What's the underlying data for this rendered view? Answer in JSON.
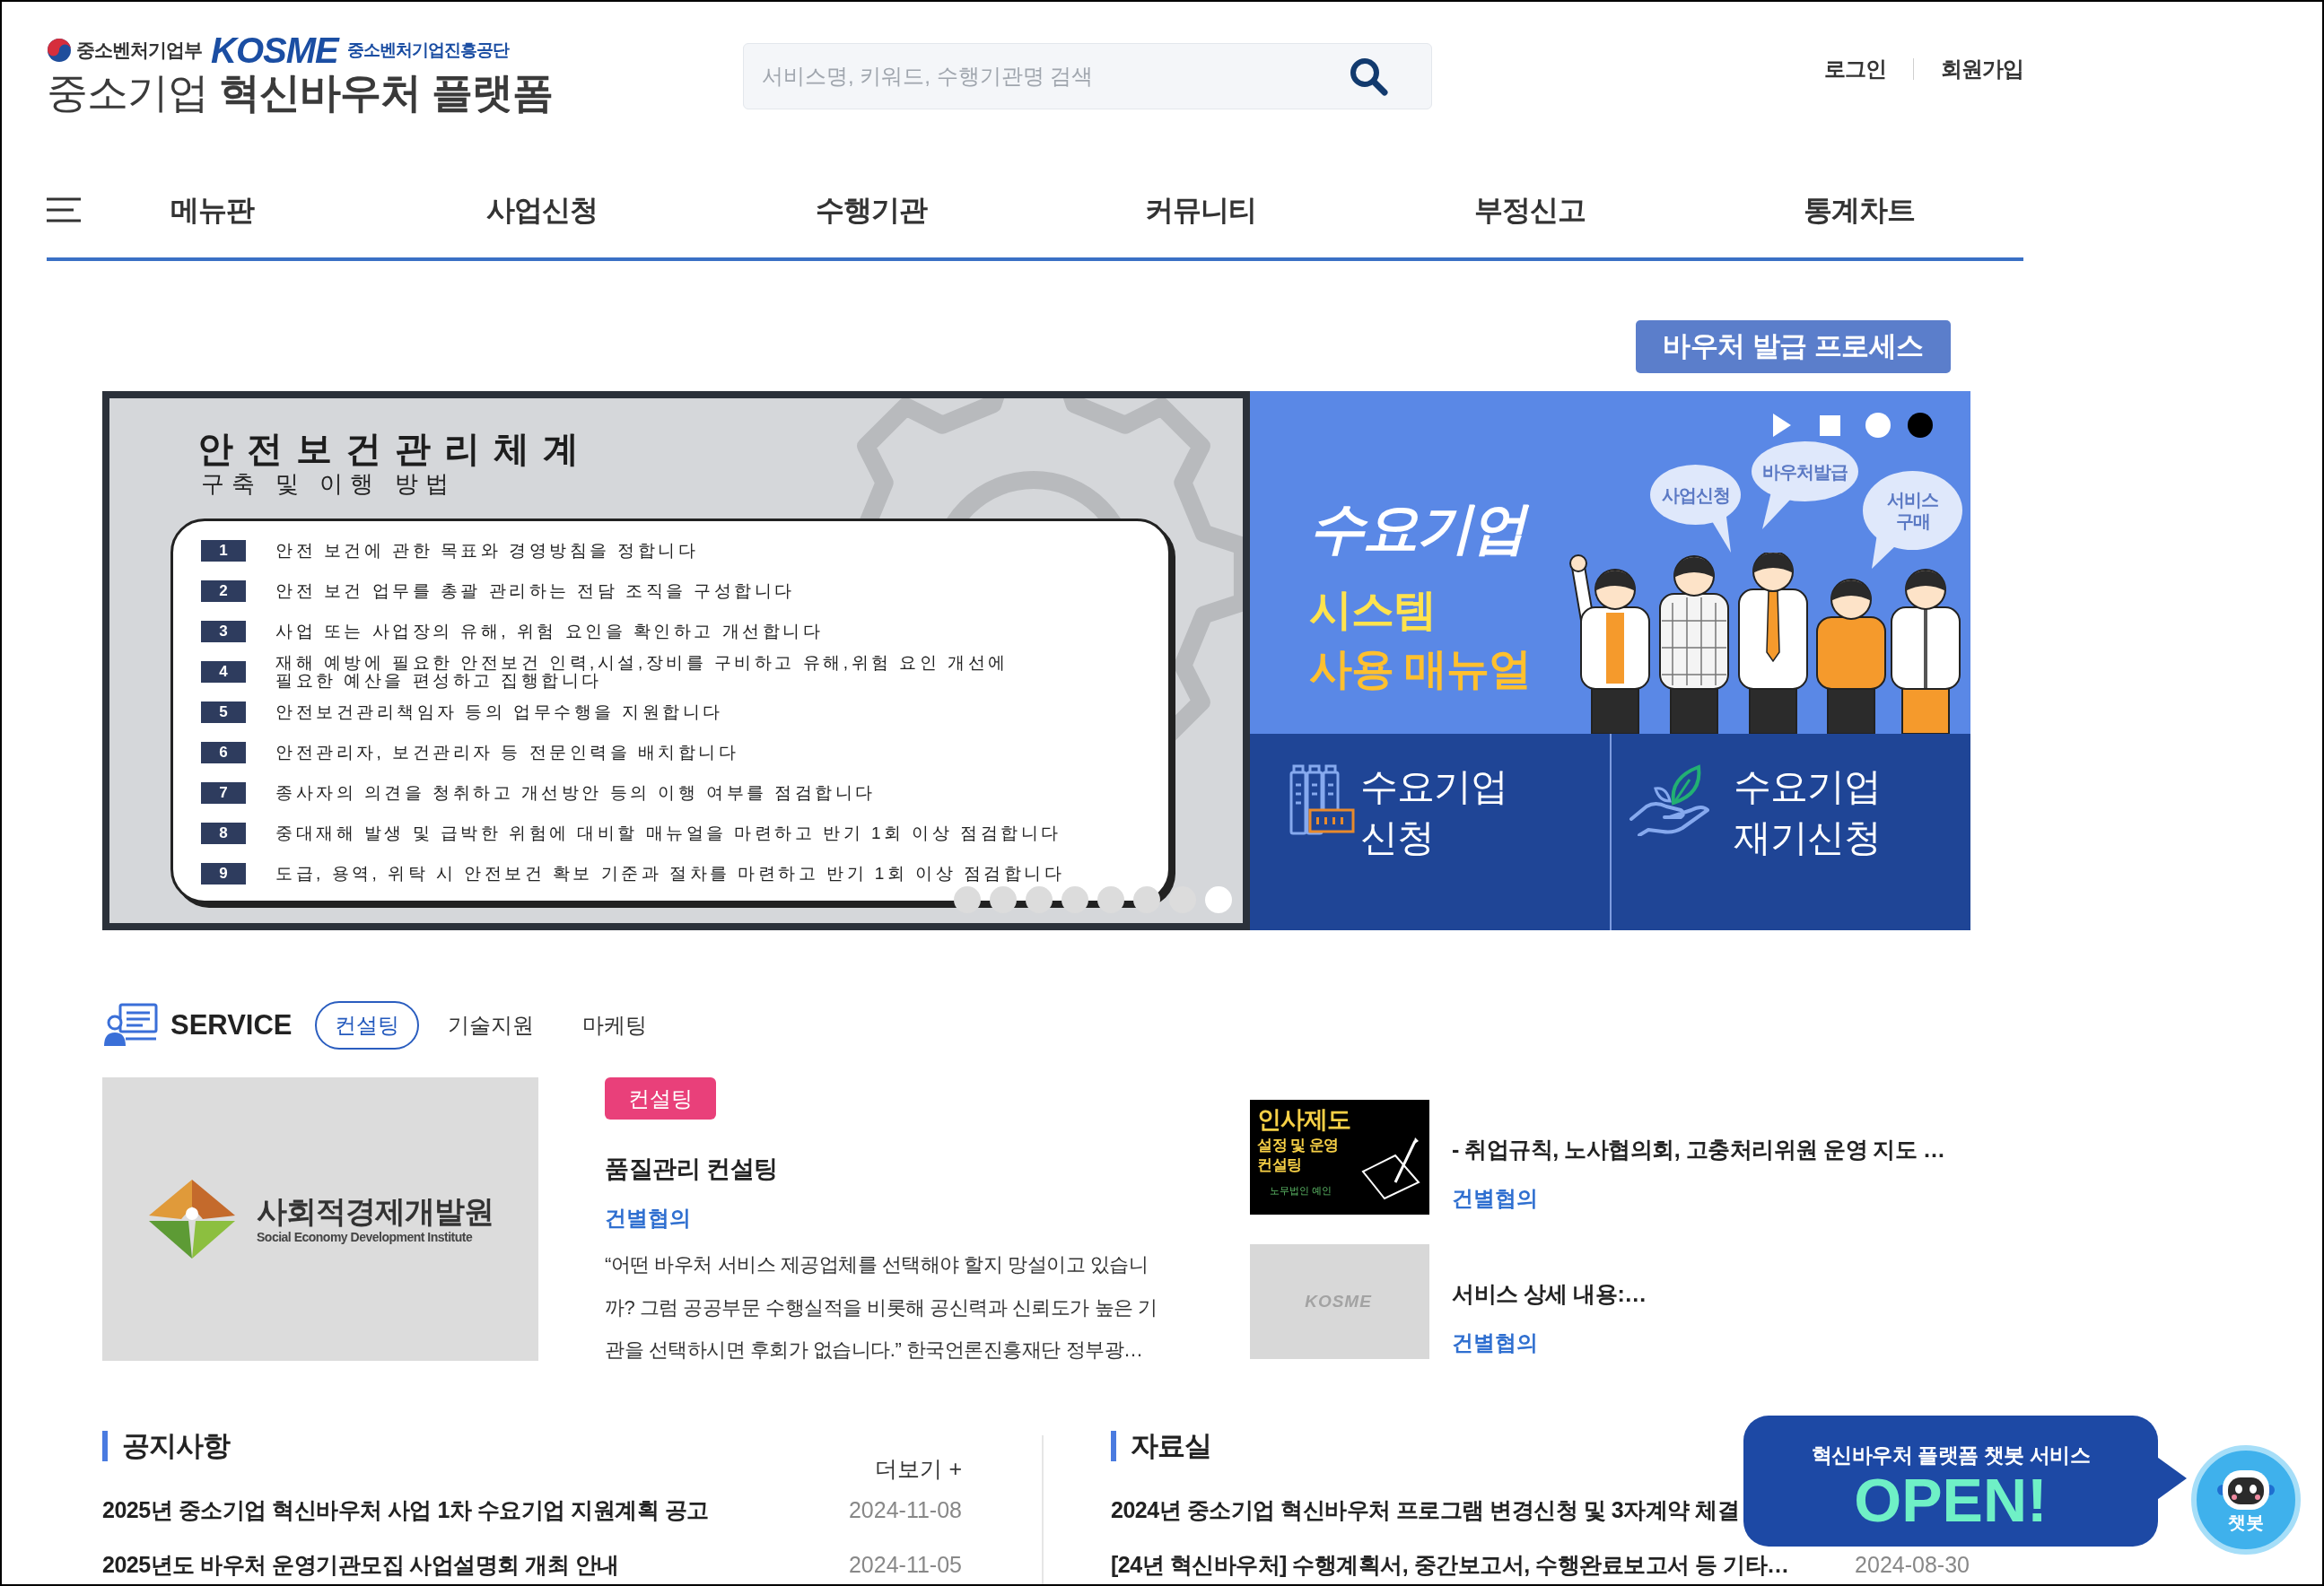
{
  "header": {
    "ministry": "중소벤처기업부",
    "agency_logo": "KOSME",
    "agency": "중소벤처기업진흥공단",
    "title": "중소기업 **혁신바우처 플랫폼**",
    "search": {
      "placeholder": "서비스명, 키워드, 수행기관명 검색"
    },
    "user_links": [
      "로그인",
      "회원가입"
    ]
  },
  "nav": {
    "items": [
      "메뉴판",
      "사업신청",
      "수행기관",
      "커뮤니티",
      "부정신고",
      "통계차트"
    ]
  },
  "process_button": "바우처 발급 프로세스",
  "banner": {
    "slide": {
      "title": "안전보건관리체계",
      "subtitle": "구축 및 이행 방법",
      "steps": [
        {
          "number": "1",
          "text": "안전 보건에 관한 목표와 경영방침을 정합니다"
        },
        {
          "number": "2",
          "text": "안전 보건 업무를 총괄 관리하는 전담 조직을 구성합니다"
        },
        {
          "number": "3",
          "text": "사업 또는 사업장의 유해, 위험 요인을 확인하고 개선합니다"
        },
        {
          "number": "4",
          "text": "재해 예방에 필요한 안전보건 인력,시설,장비를 구비하고 유해,위험 요인 개선에\n필요한 예산을 편성하고 집행합니다"
        },
        {
          "number": "5",
          "text": "안전보건관리책임자 등의 업무수행을 지원합니다"
        },
        {
          "number": "6",
          "text": "안전관리자, 보건관리자 등 전문인력을 배치합니다"
        },
        {
          "number": "7",
          "text": "종사자의 의견을 청취하고 개선방안 등의 이행 여부를 점검합니다"
        },
        {
          "number": "8",
          "text": "중대재해 발생 및 급박한 위험에 대비할 매뉴얼을 마련하고 반기 1회 이상 점검합니다"
        },
        {
          "number": "9",
          "text": "도급, 용역, 위탁 시 안전보건 확보 기준과 절차를 마련하고 반기 1회 이상 점검합니다"
        }
      ],
      "pagination": [
        {
          "selected": false
        },
        {
          "selected": false
        },
        {
          "selected": false
        },
        {
          "selected": false
        },
        {
          "selected": false
        },
        {
          "selected": false
        },
        {
          "selected": false
        },
        {
          "selected": true
        }
      ]
    },
    "promo": {
      "headline": "수요기업",
      "line_2": "시스템",
      "line_3": "사용 매뉴얼",
      "bubbles": [
        "사업신청",
        "바우처발급",
        "서비스 구매"
      ],
      "slides": [
        {
          "selected": false
        },
        {
          "selected": true
        }
      ]
    },
    "tiles": [
      {
        "kind": "factory",
        "label": "수요기업 신청"
      },
      {
        "kind": "hand-leaf",
        "label": "수요기업 재기신청"
      }
    ]
  },
  "service": {
    "title": "SERVICE",
    "tabs": [
      {
        "label": "컨설팅",
        "selected": true
      },
      {
        "label": "기술지원",
        "selected": false
      },
      {
        "label": "마케팅",
        "selected": false
      }
    ],
    "featured": {
      "logo": {
        "name": "사회적경제개발원",
        "subtitle": "Social Economy Development Institute"
      },
      "badge": "컨설팅",
      "title": "품질관리 컨설팅",
      "price": "건별협의",
      "description": "“어떤 바우처 서비스 제공업체를 선택해야 할지 망설이고 있습니까? 그럼 공공부문 수행실적을 비롯해 공신력과 신뢰도가 높은 기관을 선택하시면 후회가 없습니다.” 한국언론진흥재단 정부광…"
    },
    "items": [
      {
        "thumbnail": {
          "kind": "poster",
          "title": "인사제도",
          "subtitle": "설정 및 운영\n컨설팅",
          "footer": "노무법인 예인"
        },
        "title": "- 취업규칙, 노사협의회, 고충처리위원 운영 지도 …",
        "price": "건별협의"
      },
      {
        "thumbnail": {
          "kind": "logo",
          "text": "KOSME"
        },
        "title": "서비스 상세 내용:…",
        "price": "건별협의"
      }
    ]
  },
  "notices": {
    "title": "공지사항",
    "more": "더보기 +",
    "rows": [
      {
        "title": "2025년 중소기업 혁신바우처 사업 1차 수요기업 지원계획 공고",
        "date": "2024-11-08"
      },
      {
        "title": "2025년도 바우처 운영기관모집 사업설명회 개최 안내",
        "date": "2024-11-05"
      }
    ]
  },
  "archive": {
    "title": "자료실",
    "rows": [
      {
        "title": "2024년 중소기업 혁신바우처 프로그램 변경신청 및 3자계약 체결"
      },
      {
        "title": "[24년 혁신바우처] 수행계획서, 중간보고서, 수행완료보고서 등 기타…",
        "date": "2024-08-30"
      }
    ]
  },
  "chatbot": {
    "caption": "혁신바우처 플랫폼 챗봇 서비스",
    "headline": "OPEN!",
    "label": "챗봇"
  }
}
